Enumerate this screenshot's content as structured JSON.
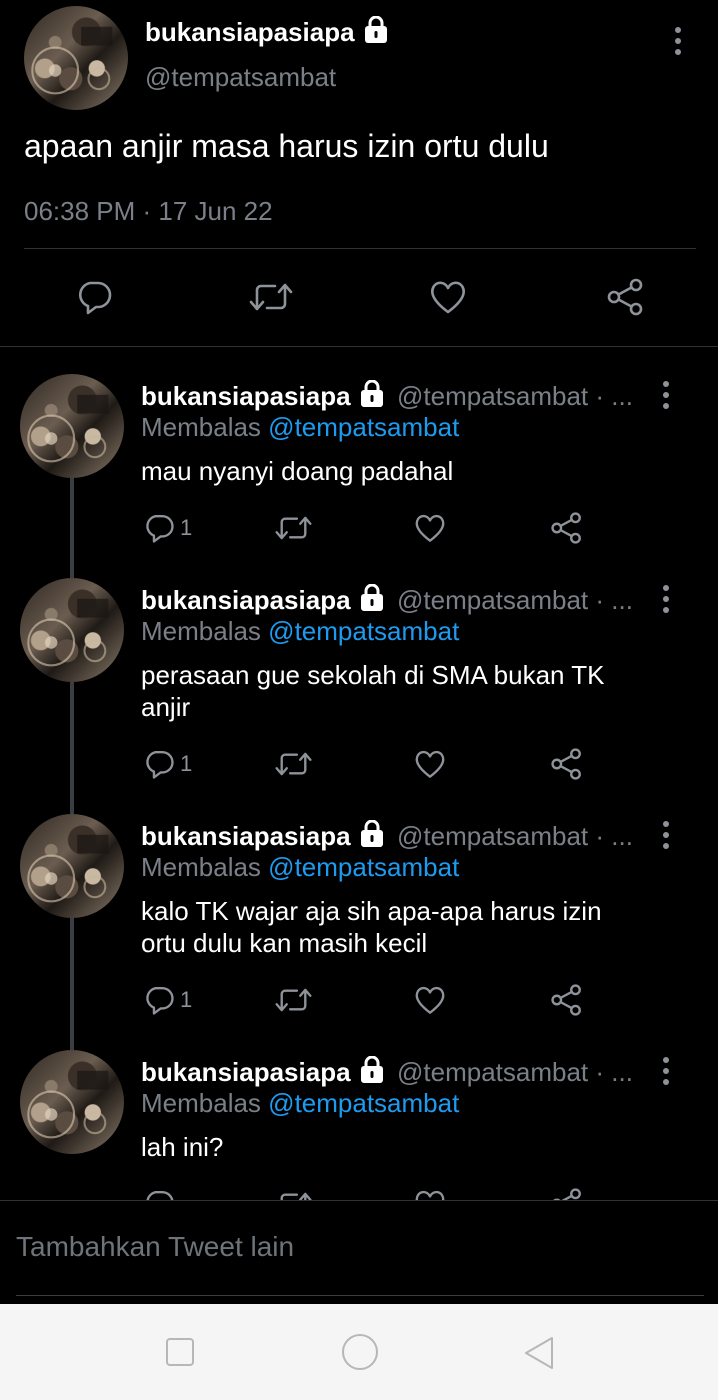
{
  "main_tweet": {
    "display_name": "bukansiapasiapa",
    "handle": "@tempatsambat",
    "text": "apaan anjir masa harus izin ortu dulu",
    "timestamp": "06:38 PM · 17 Jun 22",
    "actions": [
      "reply-icon",
      "retweet-icon",
      "like-icon",
      "share-icon"
    ]
  },
  "replies": [
    {
      "display_name": "bukansiapasiapa",
      "handle": "@tempatsambat · ...",
      "replying_prefix": "Membalas",
      "replying_to": "@tempatsambat",
      "text_lines": [
        "mau nyanyi doang padahal"
      ],
      "reply_count": "1"
    },
    {
      "display_name": "bukansiapasiapa",
      "handle": "@tempatsambat · ...",
      "replying_prefix": "Membalas",
      "replying_to": "@tempatsambat",
      "text_lines": [
        "perasaan gue sekolah di SMA bukan TK",
        "anjir"
      ],
      "reply_count": "1"
    },
    {
      "display_name": "bukansiapasiapa",
      "handle": "@tempatsambat · ...",
      "replying_prefix": "Membalas",
      "replying_to": "@tempatsambat",
      "text_lines": [
        "kalo TK wajar aja sih apa-apa harus izin",
        "ortu dulu kan masih kecil"
      ],
      "reply_count": "1"
    },
    {
      "display_name": "bukansiapasiapa",
      "handle": "@tempatsambat · ...",
      "replying_prefix": "Membalas",
      "replying_to": "@tempatsambat",
      "text_lines": [
        "lah ini?"
      ],
      "reply_count": ""
    }
  ],
  "composer": {
    "placeholder": "Tambahkan Tweet lain"
  },
  "nav_bar": {
    "buttons": [
      "recents-square-icon",
      "home-circle-icon",
      "back-triangle-icon"
    ]
  },
  "colors": {
    "background": "#000000",
    "accent": "#1d9bf0",
    "secondary_text": "#7b8088",
    "nav_bar": "#f5f5f5"
  }
}
